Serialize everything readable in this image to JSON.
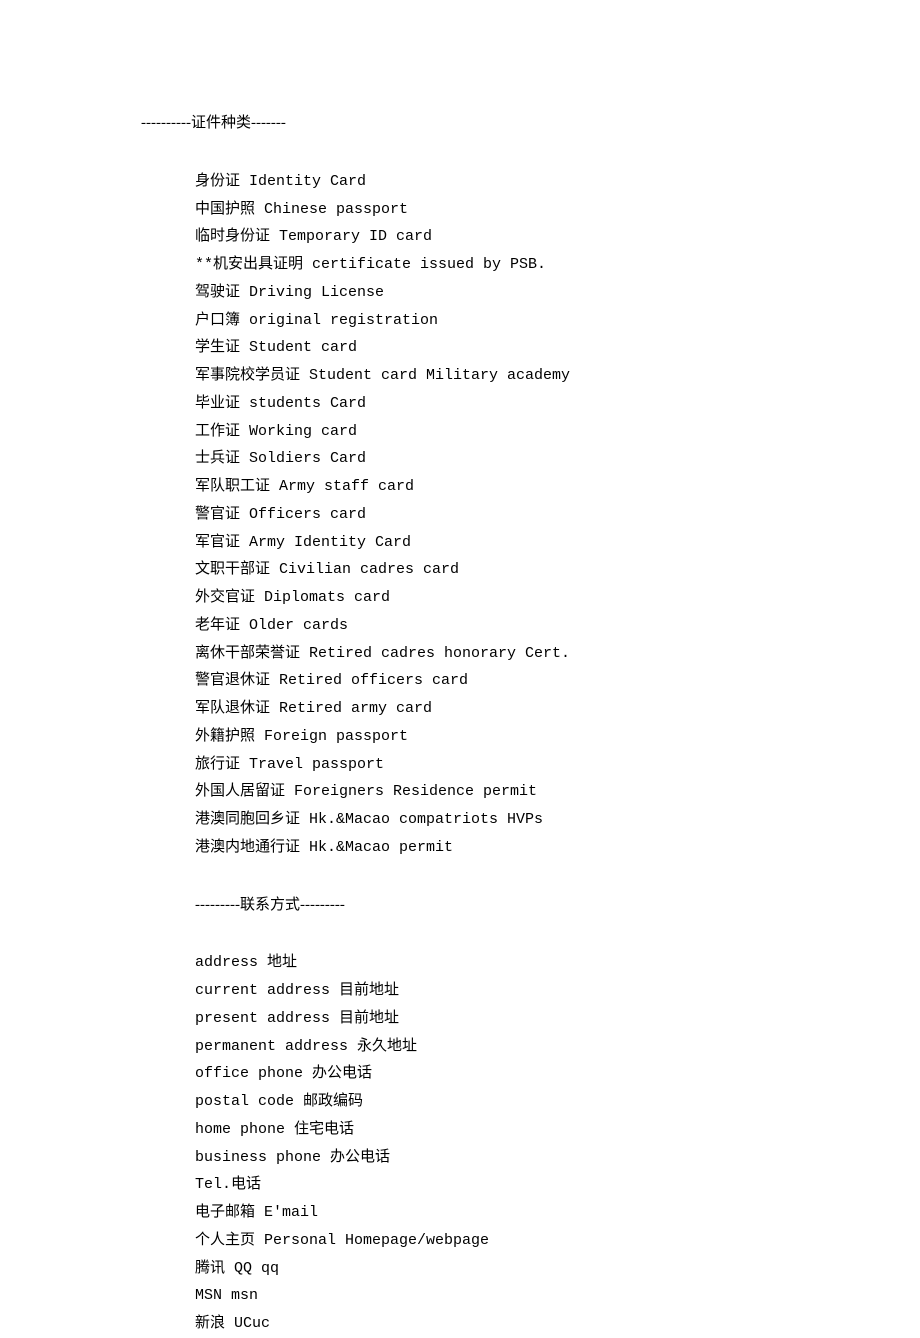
{
  "section1_header": "----------证件种类-------",
  "section1_lines": [
    "身份证 Identity Card",
    "中国护照 Chinese passport",
    "临时身份证 Temporary ID card",
    "**机安出具证明 certificate issued by PSB.",
    "驾驶证 Driving License",
    "户口簿 original registration",
    "学生证 Student card",
    "军事院校学员证 Student card Military academy",
    "毕业证 students Card",
    "工作证 Working card",
    "士兵证 Soldiers Card",
    "军队职工证 Army staff card",
    "警官证 Officers card",
    "军官证 Army Identity Card",
    "文职干部证 Civilian cadres card",
    "外交官证 Diplomats card",
    "老年证 Older cards",
    "离休干部荣誉证 Retired cadres honorary Cert.",
    "警官退休证 Retired officers card",
    "军队退休证 Retired army card",
    "外籍护照 Foreign passport",
    "旅行证 Travel passport",
    "外国人居留证 Foreigners Residence permit",
    "港澳同胞回乡证 Hk.&Macao compatriots HVPs",
    "港澳内地通行证 Hk.&Macao permit"
  ],
  "section2_header": "---------联系方式---------",
  "section2_lines": [
    "address 地址",
    "current address 目前地址",
    "present address 目前地址",
    "permanent address 永久地址",
    "office phone 办公电话",
    "postal code 邮政编码",
    "home phone 住宅电话",
    "business phone 办公电话",
    "Tel.电话",
    "电子邮箱 E'mail",
    "个人主页 Personal Homepage/webpage",
    "腾讯 QQ qq",
    "MSN msn",
    "新浪 UCuc"
  ]
}
